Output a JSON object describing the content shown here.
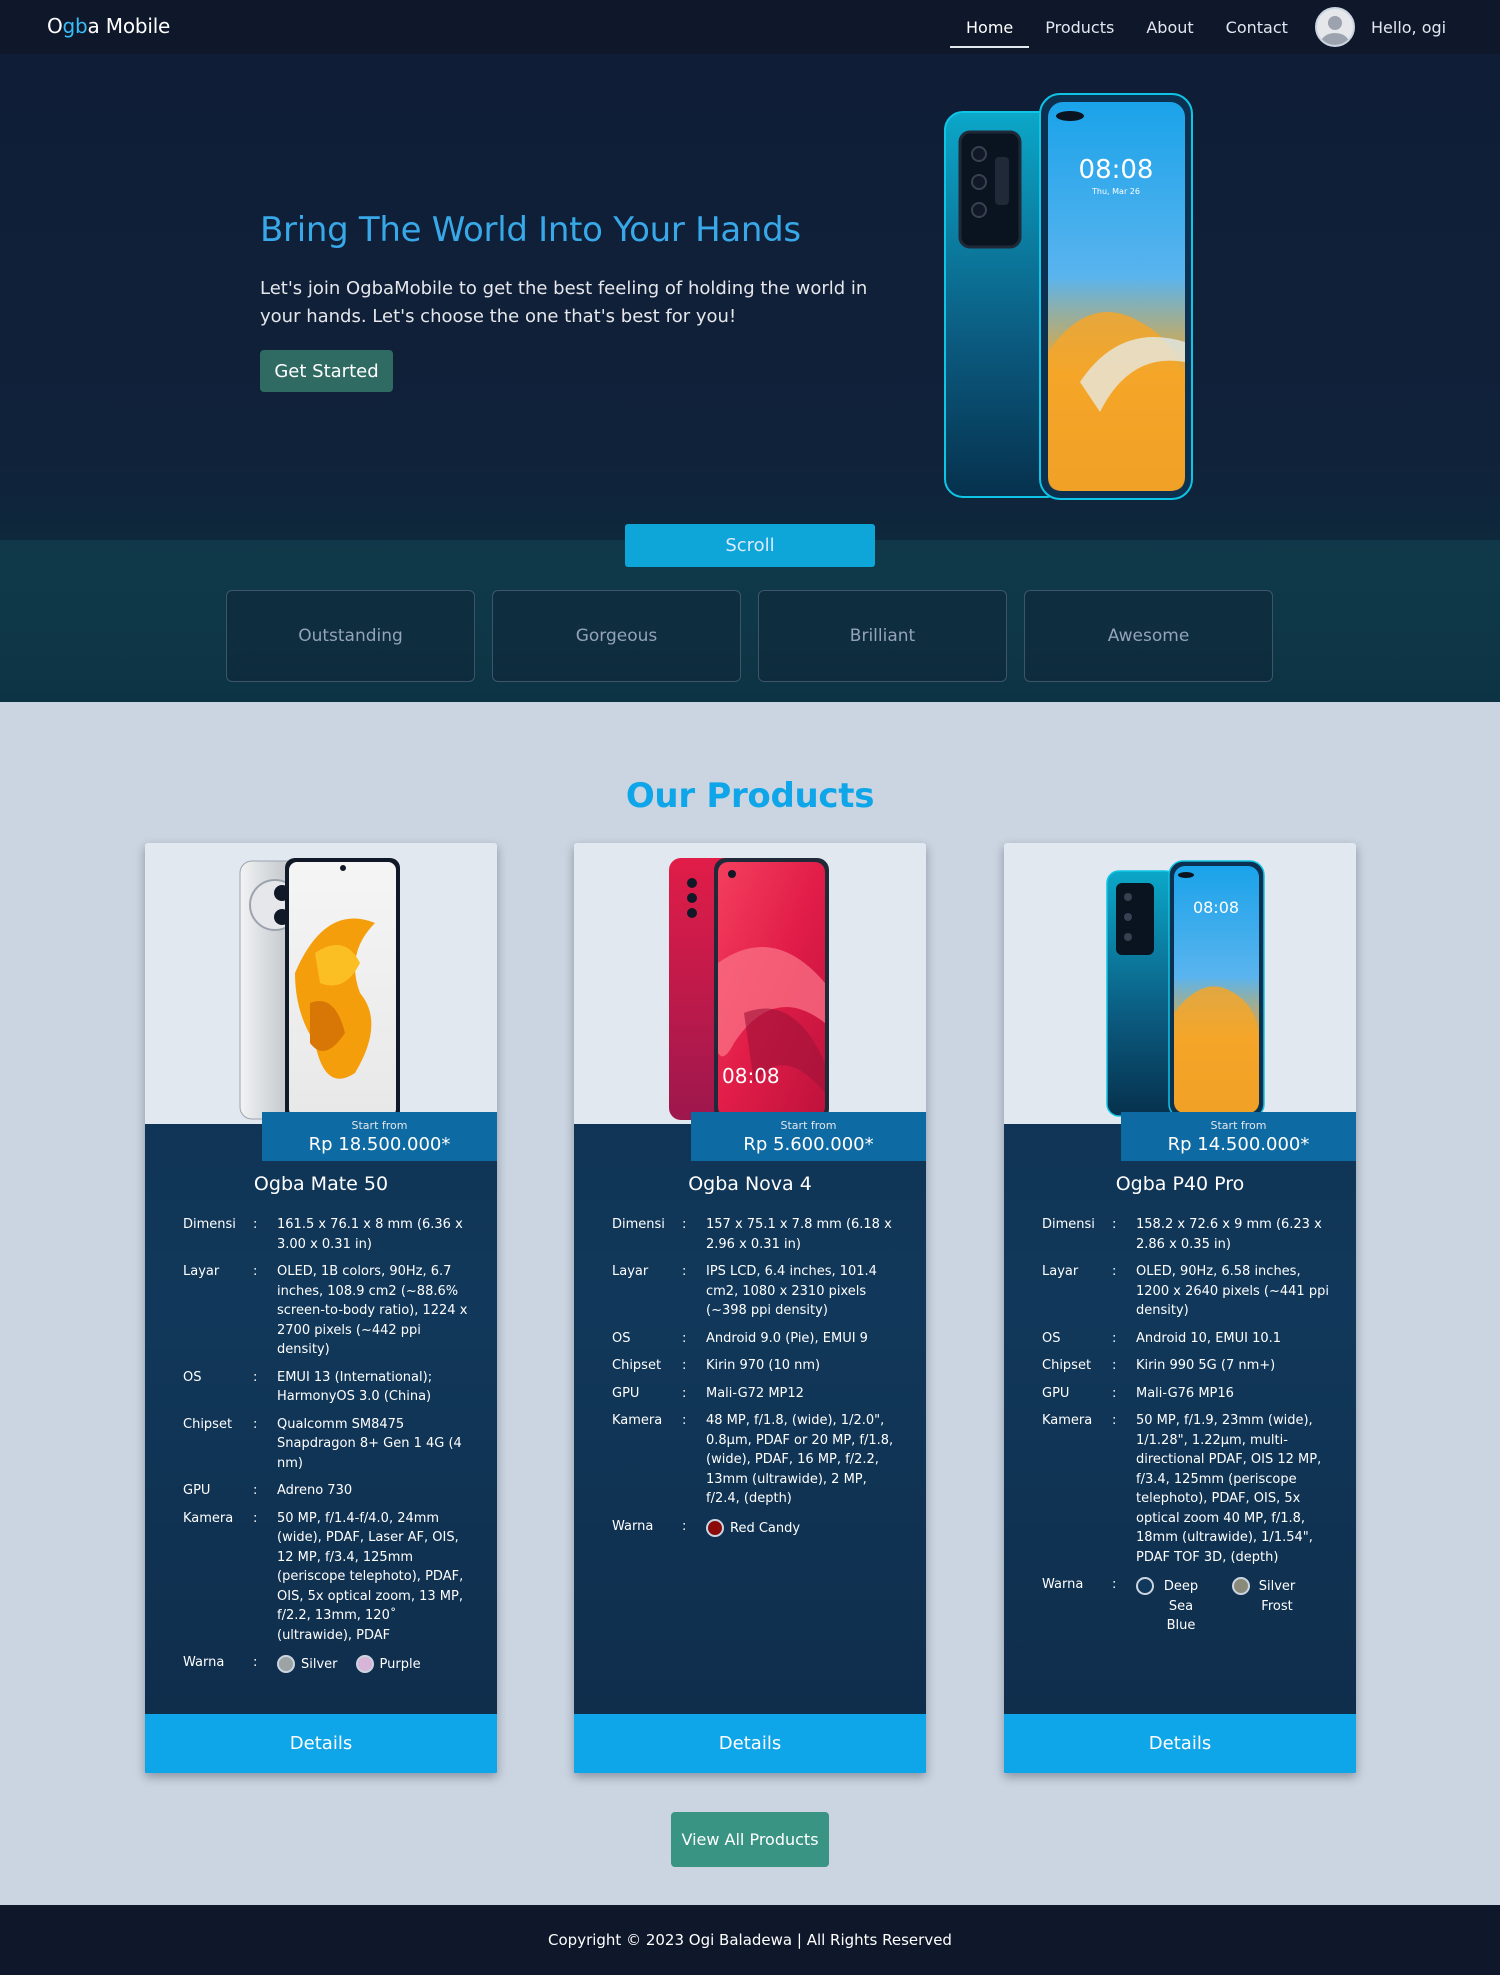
{
  "nav": {
    "brand_parts": [
      "O",
      "gb",
      "a Mobile"
    ],
    "links": [
      "Home",
      "Products",
      "About",
      "Contact"
    ],
    "active": "Home",
    "greeting": "Hello, ogi"
  },
  "hero": {
    "title": "Bring The World Into Your Hands",
    "description": "Let's join OgbaMobile to get the best feeling of holding the world in your hands. Let's choose the one that's best for you!",
    "cta_label": "Get Started",
    "scroll_label": "Scroll",
    "features": [
      "Outstanding",
      "Gorgeous",
      "Brilliant",
      "Awesome"
    ],
    "phone_time": "08:08",
    "phone_date": "Thu, Mar 26"
  },
  "products": {
    "title": "Our Products",
    "price_from_label": "Start from",
    "spec_labels": {
      "dims": "Dimensi",
      "screen": "Layar",
      "os": "OS",
      "chipset": "Chipset",
      "gpu": "GPU",
      "camera": "Kamera",
      "colors": "Warna"
    },
    "details_label": "Details",
    "view_all_label": "View All Products",
    "items": [
      {
        "name": "Ogba Mate 50",
        "price": "Rp 18.500.000*",
        "dims": "161.5 x 76.1 x 8 mm (6.36 x 3.00 x 0.31 in)",
        "screen": "OLED, 1B colors, 90Hz, 6.7 inches, 108.9 cm2 (~88.6% screen-to-body ratio), 1224 x 2700 pixels (~442 ppi density)",
        "os": "EMUI 13 (International); HarmonyOS 3.0 (China)",
        "chipset": "Qualcomm SM8475 Snapdragon 8+ Gen 1 4G (4 nm)",
        "gpu": "Adreno 730",
        "camera": "50 MP, f/1.4-f/4.0, 24mm (wide), PDAF, Laser AF, OIS, 12 MP, f/3.4, 125mm (periscope telephoto), PDAF, OIS, 5x optical zoom, 13 MP, f/2.2, 13mm, 120˚ (ultrawide), PDAF",
        "colors": [
          {
            "name": "Silver",
            "hex": "#9ca3a4"
          },
          {
            "name": "Purple",
            "hex": "#d8b4d8"
          }
        ]
      },
      {
        "name": "Ogba Nova 4",
        "price": "Rp 5.600.000*",
        "dims": "157 x 75.1 x 7.8 mm (6.18 x 2.96 x 0.31 in)",
        "screen": "IPS LCD, 6.4 inches, 101.4 cm2, 1080 x 2310 pixels (~398 ppi density)",
        "os": "Android 9.0 (Pie), EMUI 9",
        "chipset": "Kirin 970 (10 nm)",
        "gpu": "Mali-G72 MP12",
        "camera": "48 MP, f/1.8, (wide), 1/2.0\", 0.8µm, PDAF or 20 MP, f/1.8, (wide), PDAF, 16 MP, f/2.2, 13mm (ultrawide), 2 MP, f/2.4, (depth)",
        "colors": [
          {
            "name": "Red Candy",
            "hex": "#8b0a0a"
          }
        ],
        "phone_time": "08:08"
      },
      {
        "name": "Ogba P40 Pro",
        "price": "Rp 14.500.000*",
        "dims": "158.2 x 72.6 x 9 mm (6.23 x 2.86 x 0.35 in)",
        "screen": "OLED, 90Hz, 6.58 inches, 1200 x 2640 pixels (~441 ppi density)",
        "os": "Android 10, EMUI 10.1",
        "chipset": "Kirin 990 5G (7 nm+)",
        "gpu": "Mali-G76 MP16",
        "camera": "50 MP, f/1.9, 23mm (wide), 1/1.28\", 1.22µm, multi-directional PDAF, OIS 12 MP, f/3.4, 125mm (periscope telephoto), PDAF, OIS, 5x optical zoom 40 MP, f/1.8, 18mm (ultrawide), 1/1.54\", PDAF TOF 3D, (depth)",
        "colors": [
          {
            "name": "Deep Sea Blue",
            "hex": "#10385a"
          },
          {
            "name": "Silver Frost",
            "hex": "#8a8a7a"
          }
        ],
        "phone_time": "08:08"
      }
    ]
  },
  "footer": {
    "text": "Copyright © 2023 Ogi Baladewa | All Rights Reserved"
  },
  "colors": {
    "nav_bg": "#0f172a",
    "accent": "#0ea5e9",
    "title_blue": "#38a8e8",
    "cta_green": "#2f6b62",
    "view_all_green": "#3a9484",
    "page_bg": "#cbd5e1"
  }
}
